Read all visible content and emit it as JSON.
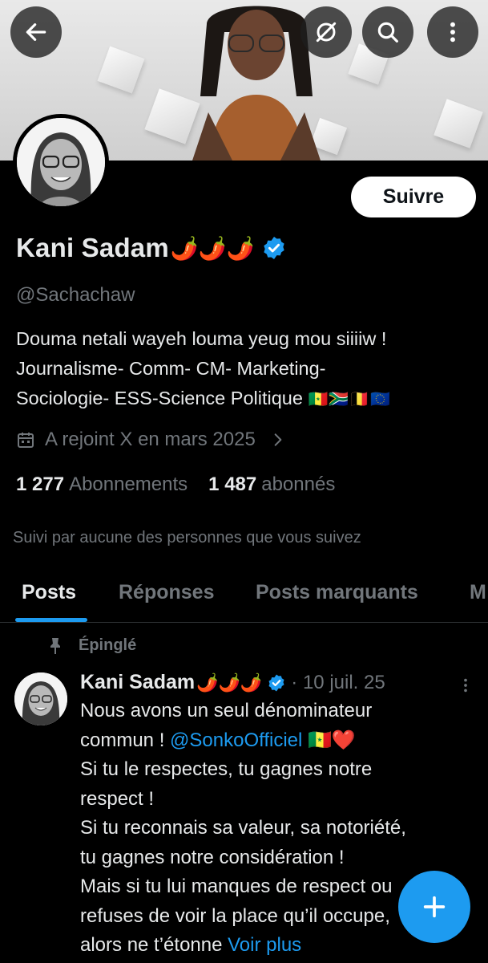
{
  "header": {
    "back_icon": "arrow-left-icon",
    "mute_icon": "rss-off-icon",
    "search_icon": "search-icon",
    "more_icon": "more-vertical-icon"
  },
  "profile": {
    "name": "Kani Sadam",
    "name_emoji": "🌶️🌶️🌶️",
    "handle": "@Sachachaw",
    "follow_label": "Suivre",
    "bio": {
      "line1": "Douma netali wayeh louma yeug mou siiiiw !",
      "line2": "Journalisme- Comm- CM- Marketing-",
      "line3": "Sociologie- ESS-Science Politique",
      "flags": "🇸🇳🇿🇦🇧🇪🇪🇺"
    },
    "joined": "A rejoint X en mars 2025",
    "following_count": "1 277",
    "following_label": "Abonnements",
    "followers_count": "1 487",
    "followers_label": "abonnés",
    "followed_by": "Suivi par aucune des personnes que vous suivez"
  },
  "tabs": [
    {
      "label": "Posts",
      "active": true
    },
    {
      "label": "Réponses",
      "active": false
    },
    {
      "label": "Posts marquants",
      "active": false
    },
    {
      "label": "M",
      "active": false
    }
  ],
  "pinned_post": {
    "pinned_label": "Épinglé",
    "author": "Kani Sadam",
    "author_emoji": "🌶️🌶️🌶️",
    "date": "· 10 juil. 25",
    "text_1": "Nous avons un seul dénominateur",
    "text_2_prefix": "commun ! ",
    "mention": "@SonkoOfficiel",
    "text_2_suffix": " 🇸🇳❤️",
    "text_3": "Si tu le respectes, tu gagnes notre",
    "text_4": "respect !",
    "text_5": "Si tu reconnais sa valeur, sa notoriété,",
    "text_6": "tu gagnes notre considération !",
    "text_7": "Mais si tu lui manques de respect ou",
    "text_8": "refuses de voir la place qu’il occupe,",
    "text_9_prefix": "alors ne t’étonne ",
    "more_label": "Voir plus"
  },
  "colors": {
    "accent": "#1d9bf0",
    "background": "#000000",
    "secondary_text": "#71767b"
  }
}
